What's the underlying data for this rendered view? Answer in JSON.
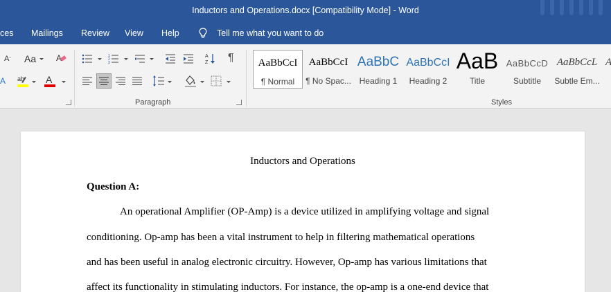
{
  "window": {
    "title": "Inductors and Operations.docx [Compatibility Mode]  -  Word"
  },
  "menu": {
    "items": [
      "ces",
      "Mailings",
      "Review",
      "View",
      "Help"
    ],
    "tell_me": "Tell me what you want to do"
  },
  "ribbon": {
    "font_size_button": "Aa",
    "paragraph_group": "Paragraph",
    "styles_group": "Styles",
    "styles": [
      {
        "sample": "AaBbCcI",
        "name": "¶ Normal"
      },
      {
        "sample": "AaBbCcI",
        "name": "¶ No Spac..."
      },
      {
        "sample": "AaBbC",
        "name": "Heading 1"
      },
      {
        "sample": "AaBbCcI",
        "name": "Heading 2"
      },
      {
        "sample": "AaB",
        "name": "Title"
      },
      {
        "sample": "AaBbCcD",
        "name": "Subtitle"
      },
      {
        "sample": "AaBbCcL",
        "name": "Subtle Em..."
      }
    ],
    "colors": {
      "highlight": "#ffff00",
      "font_color": "#e00000",
      "title_blue": "#2b579a"
    }
  },
  "document": {
    "title": "Inductors and Operations",
    "heading": "Question A:",
    "lines": [
      "An operational Amplifier (OP-Amp) is a device utilized in amplifying voltage and signal",
      "conditioning. Op-amp has been a vital instrument to help in filtering mathematical operations",
      "and has been useful in analog electronic circuitry. However, Op-amp has various limitations that",
      "affect its functionality in stimulating inductors. For instance, the op-amp is a one-end device that"
    ]
  }
}
